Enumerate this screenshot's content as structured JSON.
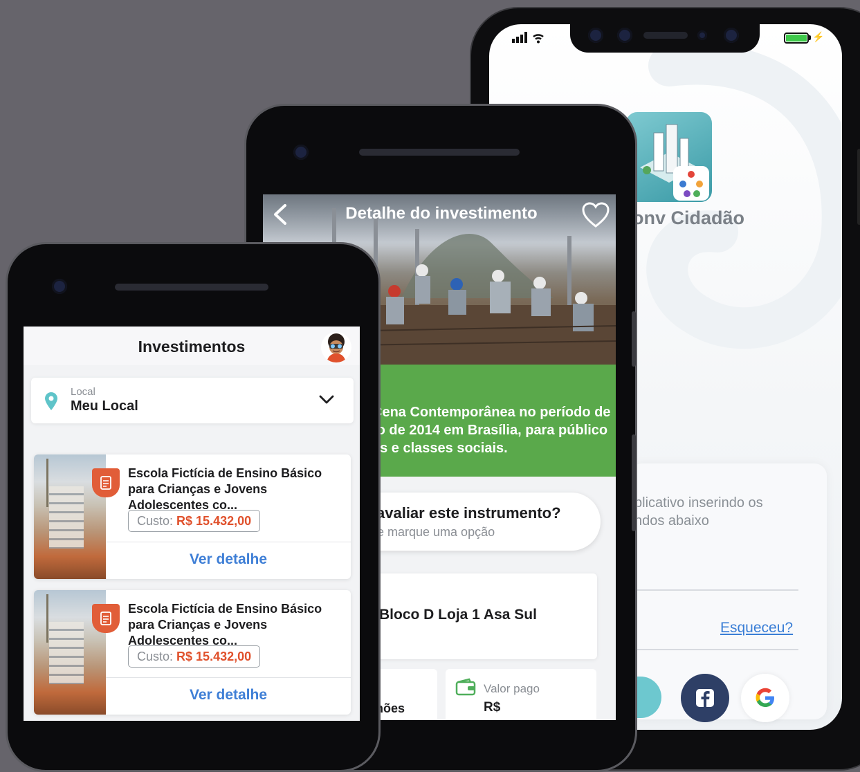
{
  "colors": {
    "background": "#66646b",
    "green": "#5aa94b",
    "link_blue": "#3f7fd6",
    "cost_red": "#e0512c",
    "badge_orange": "#e15d38",
    "teal": "#6dc8cf",
    "facebook": "#2e3f66"
  },
  "phone_right": {
    "app_name": "onv Cidadão",
    "instructions": "plicativo inserindo os\nndos abaixo",
    "forgot_link": "Esqueceu?",
    "icons": [
      "signal-icon",
      "wifi-icon",
      "battery-icon",
      "facebook-icon",
      "google-icon"
    ]
  },
  "phone_middle": {
    "title": "Detalhe do investimento",
    "description": "Cena Contemporânea no período de\nto de 2014 em Brasília, para público\nes e classes sociais.",
    "rate_question": "avaliar este instrumento?",
    "rate_hint": "e marque uma opção",
    "address": "Bloco D Loja 1 Asa Sul",
    "conditions_label": "nões",
    "paid_label": "Valor pago",
    "paid_value": "R$",
    "icons": [
      "back-arrow-icon",
      "heart-icon",
      "wallet-icon"
    ]
  },
  "phone_left": {
    "title": "Investimentos",
    "location_label": "Local",
    "location_value": "Meu Local",
    "items": [
      {
        "title": "Escola Fictícia de Ensino Básico para Crianças e Jovens Adolescentes co...",
        "cost_label": "Custo: ",
        "cost_value": "R$ 15.432,00",
        "link": "Ver detalhe"
      },
      {
        "title": "Escola Fictícia de Ensino Básico para Crianças e Jovens Adolescentes co...",
        "cost_label": "Custo: ",
        "cost_value": "R$ 15.432,00",
        "link": "Ver detalhe"
      }
    ],
    "icons": [
      "avatar-icon",
      "location-pin-icon",
      "chevron-down-icon",
      "document-badge-icon"
    ]
  }
}
